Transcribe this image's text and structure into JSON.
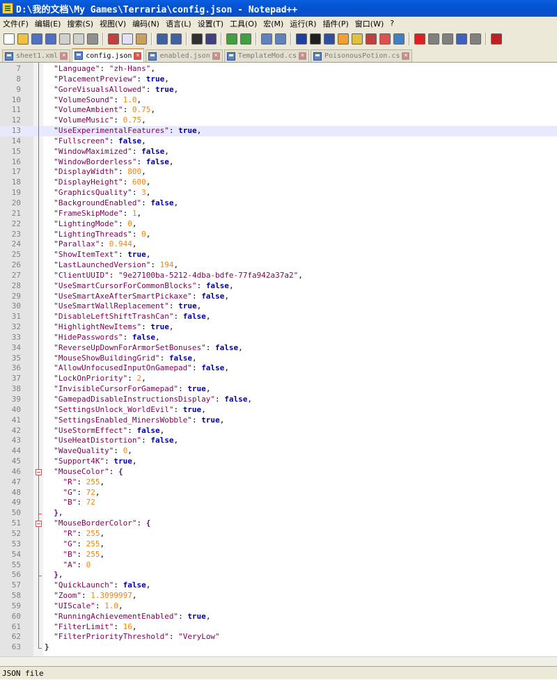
{
  "window": {
    "title": "D:\\我的文档\\My Games\\Terraria\\config.json - Notepad++"
  },
  "menu": [
    "文件(F)",
    "编辑(E)",
    "搜索(S)",
    "视图(V)",
    "编码(N)",
    "语言(L)",
    "设置(T)",
    "工具(O)",
    "宏(M)",
    "运行(R)",
    "插件(P)",
    "窗口(W)",
    "?"
  ],
  "toolbar": [
    "new-file-icon",
    "open-file-icon",
    "save-icon",
    "save-all-icon",
    "close-icon",
    "close-all-icon",
    "print-icon",
    "cut-icon",
    "copy-icon",
    "paste-icon",
    "undo-icon",
    "redo-icon",
    "find-icon",
    "replace-icon",
    "zoom-in-icon",
    "zoom-out-icon",
    "sync-vertical-icon",
    "sync-horizontal-icon",
    "word-wrap-icon",
    "show-all-chars-icon",
    "indent-guide-icon",
    "user-lang-icon",
    "doc-map-icon",
    "function-list-icon",
    "folder-workspace-icon",
    "monitor-icon",
    "record-macro-icon",
    "stop-macro-icon",
    "play-macro-icon",
    "run-macro-multiple-icon",
    "save-macro-icon",
    "spell-check-icon"
  ],
  "tabs": [
    {
      "label": "sheet1.xml",
      "active": false
    },
    {
      "label": "config.json",
      "active": true
    },
    {
      "label": "enabled.json",
      "active": false
    },
    {
      "label": "TemplateMod.cs",
      "active": false
    },
    {
      "label": "PoisonousPotion.cs",
      "active": false
    }
  ],
  "editor": {
    "current_line": 13,
    "lines": [
      {
        "n": 7,
        "code": "  \"Language\": \"zh-Hans\","
      },
      {
        "n": 8,
        "code": "  \"PlacementPreview\": true,"
      },
      {
        "n": 9,
        "code": "  \"GoreVisualsAllowed\": true,"
      },
      {
        "n": 10,
        "code": "  \"VolumeSound\": 1.0,"
      },
      {
        "n": 11,
        "code": "  \"VolumeAmbient\": 0.75,"
      },
      {
        "n": 12,
        "code": "  \"VolumeMusic\": 0.75,"
      },
      {
        "n": 13,
        "code": "  \"UseExperimentalFeatures\": true,"
      },
      {
        "n": 14,
        "code": "  \"Fullscreen\": false,"
      },
      {
        "n": 15,
        "code": "  \"WindowMaximized\": false,"
      },
      {
        "n": 16,
        "code": "  \"WindowBorderless\": false,"
      },
      {
        "n": 17,
        "code": "  \"DisplayWidth\": 800,"
      },
      {
        "n": 18,
        "code": "  \"DisplayHeight\": 600,"
      },
      {
        "n": 19,
        "code": "  \"GraphicsQuality\": 3,"
      },
      {
        "n": 20,
        "code": "  \"BackgroundEnabled\": false,"
      },
      {
        "n": 21,
        "code": "  \"FrameSkipMode\": 1,"
      },
      {
        "n": 22,
        "code": "  \"LightingMode\": 0,"
      },
      {
        "n": 23,
        "code": "  \"LightingThreads\": 0,"
      },
      {
        "n": 24,
        "code": "  \"Parallax\": 0.944,"
      },
      {
        "n": 25,
        "code": "  \"ShowItemText\": true,"
      },
      {
        "n": 26,
        "code": "  \"LastLaunchedVersion\": 194,"
      },
      {
        "n": 27,
        "code": "  \"ClientUUID\": \"9e27100ba-5212-4dba-bdfe-77fa942a37a2\","
      },
      {
        "n": 28,
        "code": "  \"UseSmartCursorForCommonBlocks\": false,"
      },
      {
        "n": 29,
        "code": "  \"UseSmartAxeAfterSmartPickaxe\": false,"
      },
      {
        "n": 30,
        "code": "  \"UseSmartWallReplacement\": true,"
      },
      {
        "n": 31,
        "code": "  \"DisableLeftShiftTrashCan\": false,"
      },
      {
        "n": 32,
        "code": "  \"HighlightNewItems\": true,"
      },
      {
        "n": 33,
        "code": "  \"HidePasswords\": false,"
      },
      {
        "n": 34,
        "code": "  \"ReverseUpDownForArmorSetBonuses\": false,"
      },
      {
        "n": 35,
        "code": "  \"MouseShowBuildingGrid\": false,"
      },
      {
        "n": 36,
        "code": "  \"AllowUnfocusedInputOnGamepad\": false,"
      },
      {
        "n": 37,
        "code": "  \"LockOnPriority\": 2,"
      },
      {
        "n": 38,
        "code": "  \"InvisibleCursorForGamepad\": true,"
      },
      {
        "n": 39,
        "code": "  \"GamepadDisableInstructionsDisplay\": false,"
      },
      {
        "n": 40,
        "code": "  \"SettingsUnlock_WorldEvil\": true,"
      },
      {
        "n": 41,
        "code": "  \"SettingsEnabled_MinersWobble\": true,"
      },
      {
        "n": 42,
        "code": "  \"UseStormEffect\": false,"
      },
      {
        "n": 43,
        "code": "  \"UseHeatDistortion\": false,"
      },
      {
        "n": 44,
        "code": "  \"WaveQuality\": 0,"
      },
      {
        "n": 45,
        "code": "  \"Support4K\": true,"
      },
      {
        "n": 46,
        "code": "  \"MouseColor\": {"
      },
      {
        "n": 47,
        "code": "    \"R\": 255,"
      },
      {
        "n": 48,
        "code": "    \"G\": 72,"
      },
      {
        "n": 49,
        "code": "    \"B\": 72"
      },
      {
        "n": 50,
        "code": "  },"
      },
      {
        "n": 51,
        "code": "  \"MouseBorderColor\": {"
      },
      {
        "n": 52,
        "code": "    \"R\": 255,"
      },
      {
        "n": 53,
        "code": "    \"G\": 255,"
      },
      {
        "n": 54,
        "code": "    \"B\": 255,"
      },
      {
        "n": 55,
        "code": "    \"A\": 0"
      },
      {
        "n": 56,
        "code": "  },"
      },
      {
        "n": 57,
        "code": "  \"QuickLaunch\": false,"
      },
      {
        "n": 58,
        "code": "  \"Zoom\": 1.3099997,"
      },
      {
        "n": 59,
        "code": "  \"UIScale\": 1.0,"
      },
      {
        "n": 60,
        "code": "  \"RunningAchievementEnabled\": true,"
      },
      {
        "n": 61,
        "code": "  \"FilterLimit\": 16,"
      },
      {
        "n": 62,
        "code": "  \"FilterPriorityThreshold\": \"VeryLow\""
      },
      {
        "n": 63,
        "code": "}"
      }
    ]
  },
  "statusbar": {
    "type": "JSON file"
  }
}
